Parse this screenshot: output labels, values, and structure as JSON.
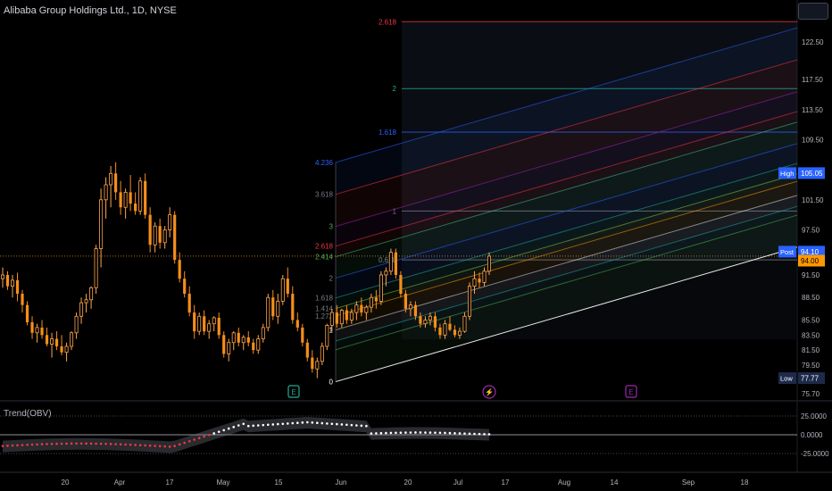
{
  "header": {
    "title": "Alibaba Group Holdings Ltd., 1D, NYSE"
  },
  "oscillator": {
    "title": "Trend(OBV)"
  },
  "colors": {
    "background": "#000000",
    "candle_up": "#ffa64d",
    "candle_down": "#f58e1a",
    "grid_line": "#2a2e39",
    "price_line": "#ff9d28",
    "fib_red": "#f23645",
    "fib_teal": "#22ab94",
    "fib_blue": "#2962ff",
    "obv_pos": "#ffffff",
    "obv_neg": "#f23645"
  },
  "chart_data": {
    "type": "candlestick",
    "y_axis": {
      "range": [
        74.5,
        126.8
      ],
      "ticks": [
        "122.50",
        "117.50",
        "113.50",
        "109.50",
        "105.05",
        "101.50",
        "97.50",
        "94.10",
        "91.50",
        "88.50",
        "85.50",
        "83.50",
        "81.50",
        "79.50",
        "77.77",
        "75.70"
      ]
    },
    "x_axis": {
      "ticks": [
        "20",
        "Apr",
        "17",
        "May",
        "15",
        "Jun",
        "20",
        "Jul",
        "17",
        "Aug",
        "14",
        "Sep",
        "18"
      ]
    },
    "price_tags": [
      {
        "label": "High",
        "value": "105.05",
        "style": "blue"
      },
      {
        "label": "Post",
        "value": "94.10",
        "style": "blue"
      },
      {
        "label": "",
        "value": "94.00",
        "style": "orange"
      },
      {
        "label": "Low",
        "value": "77.77",
        "style": "navy"
      }
    ],
    "fib_channel_levels": [
      "0",
      "1",
      "1.272",
      "1.414",
      "1.618",
      "2",
      "2.414",
      "2.618",
      "3",
      "3.618",
      "4.236"
    ],
    "fib_extension_levels": [
      {
        "label": "2.618",
        "color": "#f23645",
        "price": 125.2
      },
      {
        "label": "2",
        "color": "#22ab94",
        "price": 116.3
      },
      {
        "label": "1.618",
        "color": "#2962ff",
        "price": 110.5
      },
      {
        "label": "1",
        "color": "#787b86",
        "price": 100.0
      },
      {
        "label": "0.618",
        "color": "#787b86",
        "price": 93.5
      }
    ],
    "candle_indexes": [
      0,
      1,
      2,
      3,
      4,
      5,
      6,
      7,
      8,
      9,
      10,
      11,
      12,
      13,
      14,
      15,
      16,
      17,
      18,
      19,
      20,
      21,
      22,
      23,
      24,
      25,
      26,
      27,
      28,
      29,
      30,
      31,
      32,
      33,
      34,
      35,
      36,
      37,
      38,
      39,
      40,
      41,
      42,
      43,
      44,
      45,
      46,
      47,
      48,
      49,
      50,
      51,
      52,
      53,
      54,
      55,
      56,
      57,
      58,
      59,
      60,
      61,
      62,
      63,
      64,
      65,
      66,
      67,
      68,
      69,
      70,
      71,
      72,
      73,
      74,
      75,
      76,
      77,
      78,
      79,
      80,
      81,
      82,
      83,
      84,
      85,
      86,
      87,
      88,
      89,
      90,
      91,
      92,
      93,
      94,
      95,
      96,
      97,
      98,
      99,
      100,
      101,
      102,
      103,
      104,
      105,
      106,
      107,
      108,
      109,
      110,
      111,
      112,
      113,
      114,
      115,
      116,
      117,
      118,
      119,
      120,
      121,
      122,
      123,
      124,
      125,
      126,
      127,
      128,
      129,
      130,
      131,
      132,
      133,
      134,
      135,
      136,
      137,
      138,
      139,
      140,
      141,
      142,
      143,
      144
    ],
    "ohlc": [
      [
        91.0,
        92.5,
        89.8,
        91.5
      ],
      [
        91.5,
        92.0,
        89.5,
        90.0
      ],
      [
        90.0,
        91.5,
        88.5,
        90.8
      ],
      [
        90.8,
        91.8,
        88.0,
        89.0
      ],
      [
        89.0,
        89.5,
        86.5,
        87.5
      ],
      [
        87.5,
        88.0,
        84.8,
        85.2
      ],
      [
        85.2,
        86.0,
        83.0,
        83.8
      ],
      [
        83.8,
        85.0,
        82.5,
        84.5
      ],
      [
        84.5,
        85.5,
        83.0,
        83.5
      ],
      [
        83.5,
        84.5,
        82.0,
        82.3
      ],
      [
        82.3,
        83.8,
        80.5,
        83.0
      ],
      [
        83.0,
        84.0,
        81.5,
        82.0
      ],
      [
        82.0,
        83.5,
        80.8,
        81.2
      ],
      [
        81.2,
        82.5,
        80.0,
        82.0
      ],
      [
        82.0,
        84.0,
        81.5,
        83.8
      ],
      [
        83.8,
        86.5,
        83.0,
        86.0
      ],
      [
        86.0,
        88.5,
        85.0,
        87.8
      ],
      [
        87.8,
        89.0,
        86.5,
        88.2
      ],
      [
        88.2,
        90.0,
        87.0,
        89.8
      ],
      [
        89.8,
        95.5,
        89.0,
        95.0
      ],
      [
        95.0,
        103.0,
        92.5,
        101.5
      ],
      [
        101.5,
        104.5,
        99.0,
        103.5
      ],
      [
        103.5,
        106.0,
        100.5,
        105.0
      ],
      [
        105.0,
        106.5,
        101.5,
        102.5
      ],
      [
        102.5,
        104.0,
        99.5,
        100.5
      ],
      [
        100.5,
        103.0,
        99.0,
        102.5
      ],
      [
        102.5,
        104.8,
        100.0,
        101.0
      ],
      [
        101.0,
        102.5,
        99.5,
        100.0
      ],
      [
        100.0,
        104.5,
        99.5,
        104.0
      ],
      [
        104.0,
        105.0,
        99.0,
        99.5
      ],
      [
        99.5,
        100.5,
        94.5,
        95.5
      ],
      [
        95.5,
        98.5,
        94.5,
        98.0
      ],
      [
        98.0,
        99.0,
        95.0,
        95.8
      ],
      [
        95.8,
        98.0,
        95.0,
        97.5
      ],
      [
        97.5,
        100.5,
        96.5,
        99.5
      ],
      [
        99.5,
        100.0,
        93.0,
        93.5
      ],
      [
        93.5,
        94.5,
        90.5,
        91.0
      ],
      [
        91.0,
        92.0,
        88.5,
        89.0
      ],
      [
        89.0,
        90.0,
        86.0,
        86.5
      ],
      [
        86.5,
        87.5,
        83.0,
        84.0
      ],
      [
        84.0,
        86.5,
        83.5,
        86.0
      ],
      [
        86.0,
        86.8,
        83.5,
        84.0
      ],
      [
        84.0,
        85.5,
        83.0,
        85.0
      ],
      [
        85.0,
        86.0,
        84.0,
        85.8
      ],
      [
        85.8,
        86.5,
        83.0,
        83.5
      ],
      [
        83.5,
        84.0,
        80.5,
        81.0
      ],
      [
        81.0,
        83.0,
        80.0,
        82.5
      ],
      [
        82.5,
        84.0,
        81.5,
        83.8
      ],
      [
        83.8,
        84.5,
        82.0,
        82.5
      ],
      [
        82.5,
        83.5,
        81.5,
        83.2
      ],
      [
        83.2,
        84.0,
        82.0,
        82.5
      ],
      [
        82.5,
        83.0,
        81.0,
        81.5
      ],
      [
        81.5,
        83.5,
        81.0,
        83.0
      ],
      [
        83.0,
        85.0,
        82.5,
        84.5
      ],
      [
        84.5,
        89.0,
        84.0,
        88.5
      ],
      [
        88.5,
        89.5,
        85.5,
        86.0
      ],
      [
        86.0,
        89.0,
        85.0,
        88.0
      ],
      [
        88.0,
        91.5,
        87.5,
        91.0
      ],
      [
        91.0,
        92.5,
        88.5,
        89.0
      ],
      [
        89.0,
        90.0,
        85.0,
        85.5
      ],
      [
        85.5,
        86.5,
        84.0,
        84.5
      ],
      [
        84.5,
        85.0,
        82.0,
        82.5
      ],
      [
        82.5,
        83.0,
        80.0,
        80.5
      ],
      [
        80.5,
        81.5,
        78.5,
        79.0
      ],
      [
        79.0,
        80.5,
        77.77,
        80.0
      ],
      [
        80.0,
        82.5,
        79.5,
        82.0
      ],
      [
        82.0,
        85.0,
        81.5,
        84.8
      ],
      [
        84.8,
        87.0,
        84.0,
        86.5
      ],
      [
        86.5,
        87.5,
        84.5,
        85.0
      ],
      [
        85.0,
        87.0,
        84.5,
        86.8
      ],
      [
        86.8,
        87.5,
        85.0,
        85.5
      ],
      [
        85.5,
        87.0,
        85.0,
        86.5
      ],
      [
        86.5,
        88.0,
        85.5,
        87.5
      ],
      [
        87.5,
        88.5,
        86.0,
        86.5
      ],
      [
        86.5,
        87.5,
        85.5,
        87.2
      ],
      [
        87.2,
        89.0,
        86.5,
        88.5
      ],
      [
        88.5,
        89.5,
        87.0,
        88.0
      ],
      [
        88.0,
        92.0,
        87.5,
        91.5
      ],
      [
        91.5,
        92.5,
        90.0,
        92.0
      ],
      [
        92.0,
        95.0,
        91.5,
        94.5
      ],
      [
        94.5,
        95.0,
        91.0,
        91.5
      ],
      [
        91.5,
        92.0,
        88.5,
        89.0
      ],
      [
        89.0,
        89.5,
        86.5,
        87.0
      ],
      [
        87.0,
        88.0,
        86.0,
        87.5
      ],
      [
        87.5,
        88.0,
        85.5,
        86.0
      ],
      [
        86.0,
        86.5,
        84.5,
        85.0
      ],
      [
        85.0,
        86.0,
        84.5,
        85.5
      ],
      [
        85.5,
        86.5,
        84.8,
        86.0
      ],
      [
        86.0,
        86.5,
        84.0,
        84.5
      ],
      [
        84.5,
        85.0,
        83.0,
        83.5
      ],
      [
        83.5,
        85.5,
        83.0,
        85.0
      ],
      [
        85.0,
        86.0,
        84.0,
        84.2
      ],
      [
        84.2,
        84.8,
        83.2,
        83.5
      ],
      [
        83.5,
        84.5,
        83.0,
        84.0
      ],
      [
        84.0,
        86.5,
        83.8,
        86.0
      ],
      [
        86.0,
        90.5,
        85.5,
        90.0
      ],
      [
        90.0,
        92.0,
        89.0,
        91.0
      ],
      [
        91.0,
        91.8,
        89.8,
        90.5
      ],
      [
        90.5,
        92.5,
        90.0,
        92.0
      ],
      [
        92.0,
        94.5,
        91.5,
        94.0
      ]
    ]
  }
}
